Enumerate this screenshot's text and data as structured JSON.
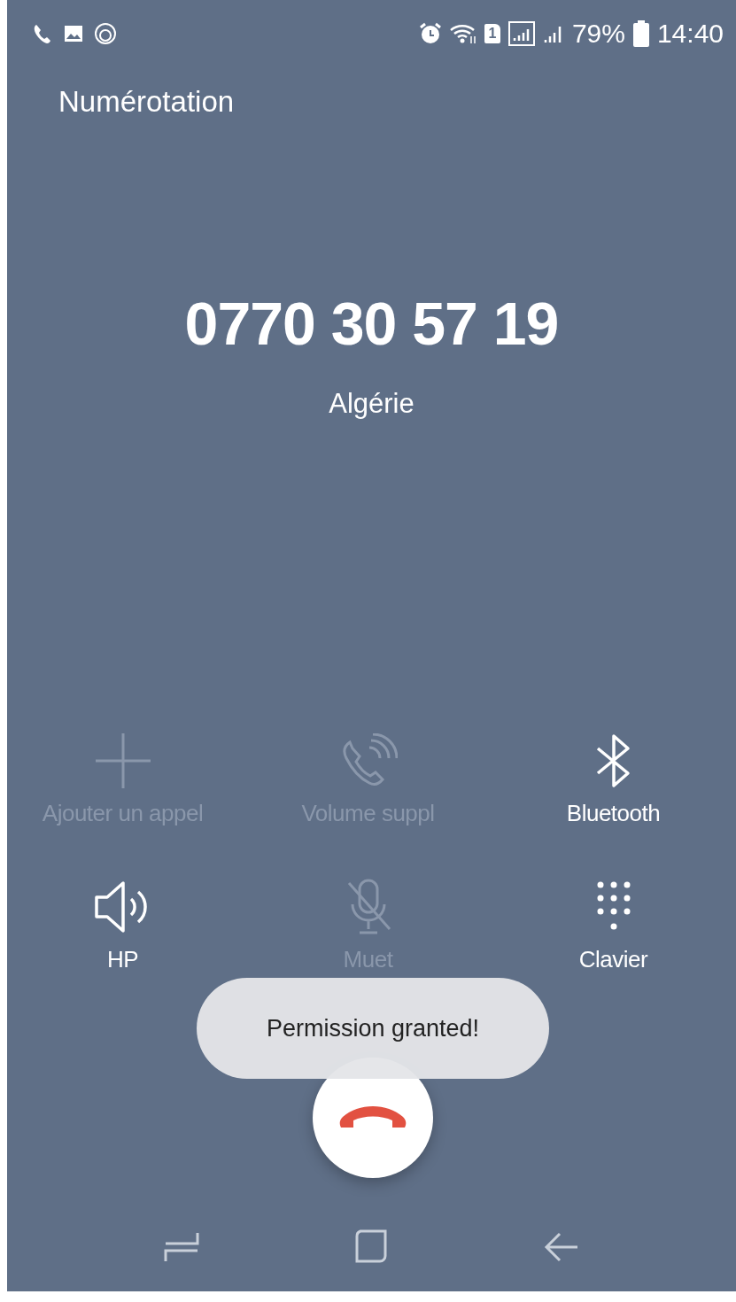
{
  "status_bar": {
    "sim_label": "1",
    "battery": "79%",
    "time": "14:40"
  },
  "title": "Numérotation",
  "call": {
    "number": "0770 30 57 19",
    "country": "Algérie"
  },
  "controls": [
    {
      "kind": "add",
      "label": "Ajouter un appel",
      "disabled": true
    },
    {
      "kind": "volume-boost",
      "label": "Volume suppl",
      "disabled": true
    },
    {
      "kind": "bluetooth",
      "label": "Bluetooth",
      "disabled": false
    },
    {
      "kind": "speaker",
      "label": "HP",
      "disabled": false
    },
    {
      "kind": "mute",
      "label": "Muet",
      "disabled": true
    },
    {
      "kind": "keypad",
      "label": "Clavier",
      "disabled": false
    }
  ],
  "toast": "Permission granted!"
}
